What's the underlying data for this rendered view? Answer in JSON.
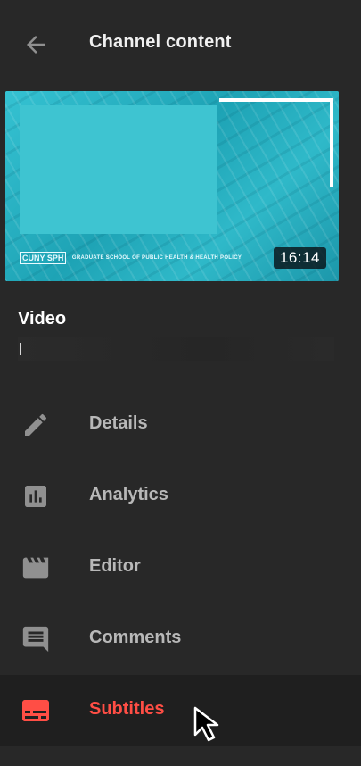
{
  "header": {
    "back_icon": "arrow-back-icon",
    "title": "Channel content"
  },
  "video": {
    "duration": "16:14",
    "thumbnail_logo": "CUNY SPH",
    "thumbnail_tagline": "GRADUATE SCHOOL OF PUBLIC HEALTH & HEALTH POLICY",
    "label": "Video"
  },
  "nav": {
    "items": [
      {
        "label": "Details",
        "icon": "pencil-icon",
        "active": false
      },
      {
        "label": "Analytics",
        "icon": "analytics-icon",
        "active": false
      },
      {
        "label": "Editor",
        "icon": "clapperboard-icon",
        "active": false
      },
      {
        "label": "Comments",
        "icon": "comment-icon",
        "active": false
      },
      {
        "label": "Subtitles",
        "icon": "subtitles-icon",
        "active": true
      }
    ]
  },
  "colors": {
    "background": "#282828",
    "active_background": "#1f1f1f",
    "active_accent": "#ff4e45",
    "inactive_text": "#b8b8b8",
    "icon_gray": "#909090",
    "thumbnail_teal": "#2ab1c1"
  }
}
